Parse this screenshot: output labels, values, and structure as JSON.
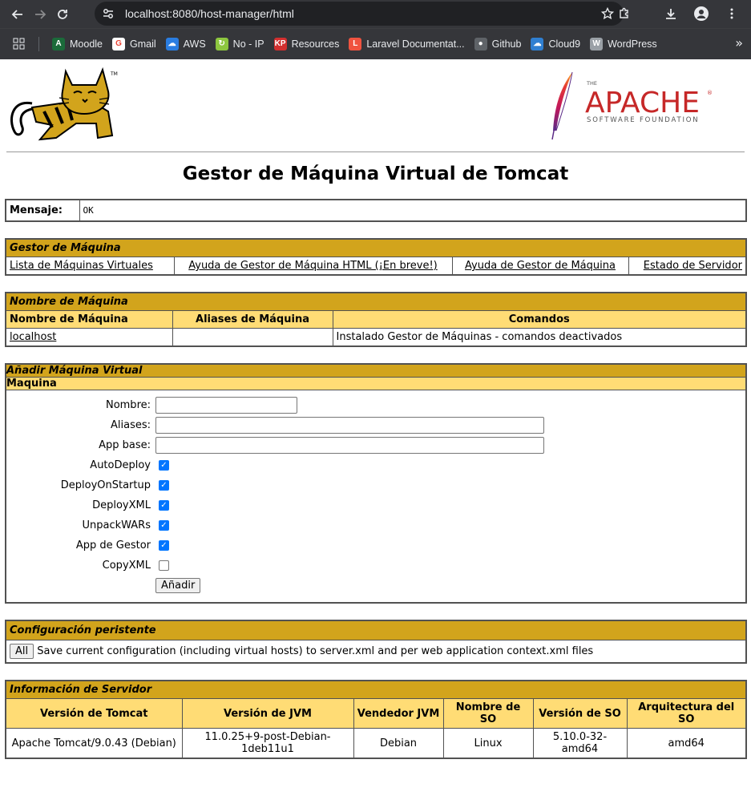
{
  "browser": {
    "url": "localhost:8080/host-manager/html",
    "bookmarks": [
      {
        "label": "Moodle",
        "color": "#1b6b3a",
        "glyph": "A"
      },
      {
        "label": "Gmail",
        "color": "#ffffff",
        "glyph": "G"
      },
      {
        "label": "AWS",
        "color": "#2a7de1",
        "glyph": "☁"
      },
      {
        "label": "No -  IP",
        "color": "#8dc63f",
        "glyph": "↻"
      },
      {
        "label": "Resources",
        "color": "#d32f2f",
        "glyph": "KP"
      },
      {
        "label": "Laravel Documentat...",
        "color": "#f05340",
        "glyph": "L"
      },
      {
        "label": "Github",
        "color": "#5f6368",
        "glyph": "●"
      },
      {
        "label": "Cloud9",
        "color": "#2f7fd1",
        "glyph": "☁"
      },
      {
        "label": "WordPress",
        "color": "#9aa0a6",
        "glyph": "W"
      }
    ]
  },
  "logos": {
    "tm": "TM",
    "apache_the": "THE",
    "apache_name": "APACHE",
    "apache_reg": "®",
    "apache_sub": "SOFTWARE FOUNDATION"
  },
  "page_title": "Gestor de Máquina Virtual de Tomcat",
  "message": {
    "label": "Mensaje:",
    "value": "OK"
  },
  "manager": {
    "title": "Gestor de Máquina",
    "links": [
      "Lista de Máquinas Virtuales",
      "Ayuda de Gestor de Máquina HTML (¡En breve!)",
      "Ayuda de Gestor de Máquina",
      "Estado de Servidor"
    ]
  },
  "hostname": {
    "title": "Nombre de Máquina",
    "headers": [
      "Nombre de Máquina",
      "Aliases de Máquina",
      "Comandos"
    ],
    "row": {
      "name": "localhost",
      "aliases": "",
      "commands": "Instalado Gestor de Máquinas - comandos deactivados"
    }
  },
  "add_host": {
    "title": "Añadir Máquina Virtual",
    "subtitle": "Maquina",
    "fields": {
      "name": "Nombre:",
      "aliases": "Aliases:",
      "app_base": "App base:"
    },
    "values": {
      "name": "",
      "aliases": "",
      "app_base": ""
    },
    "checkboxes": [
      {
        "label": "AutoDeploy",
        "checked": true
      },
      {
        "label": "DeployOnStartup",
        "checked": true
      },
      {
        "label": "DeployXML",
        "checked": true
      },
      {
        "label": "UnpackWARs",
        "checked": true
      },
      {
        "label": "App de Gestor",
        "checked": true
      },
      {
        "label": "CopyXML",
        "checked": false
      }
    ],
    "submit": "Añadir"
  },
  "persist": {
    "title": "Configuración peristente",
    "button": "All",
    "text": "Save current configuration (including virtual hosts) to server.xml and per web application context.xml files"
  },
  "server_info": {
    "title": "Información de Servidor",
    "headers": [
      "Versión de Tomcat",
      "Versión de JVM",
      "Vendedor JVM",
      "Nombre de SO",
      "Versión de SO",
      "Arquitectura del SO"
    ],
    "values": [
      "Apache Tomcat/9.0.43 (Debian)",
      "11.0.25+9-post-Debian-1deb11u1",
      "Debian",
      "Linux",
      "5.10.0-32-amd64",
      "amd64"
    ]
  },
  "colors": {
    "title_bar": "#d2a41c",
    "header_bar": "#ffdc75",
    "border": "#525252"
  }
}
